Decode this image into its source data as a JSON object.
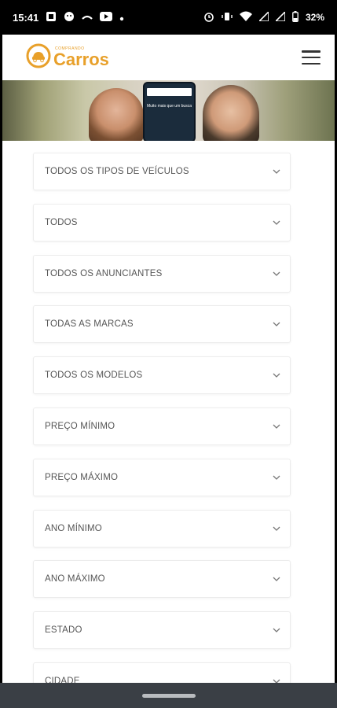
{
  "status_bar": {
    "time": "15:41",
    "battery": "32%"
  },
  "header": {
    "logo_small": "COMPRANDO",
    "logo_big": "Carros"
  },
  "banner": {
    "phone_text": "Muito mais que um busca"
  },
  "filters": [
    {
      "label": "TODOS OS TIPOS DE VEÍCULOS"
    },
    {
      "label": "TODOS"
    },
    {
      "label": "TODOS OS ANUNCIANTES"
    },
    {
      "label": "TODAS AS MARCAS"
    },
    {
      "label": "TODOS OS MODELOS"
    },
    {
      "label": "PREÇO MÍNIMO"
    },
    {
      "label": "PREÇO MÁXIMO"
    },
    {
      "label": "ANO MÍNIMO"
    },
    {
      "label": "ANO MÁXIMO"
    },
    {
      "label": "ESTADO"
    },
    {
      "label": "CIDADE"
    }
  ],
  "colors": {
    "brand": "#e8a02a",
    "status_bar": "#000000",
    "nav_bar": "#3a3f45"
  }
}
